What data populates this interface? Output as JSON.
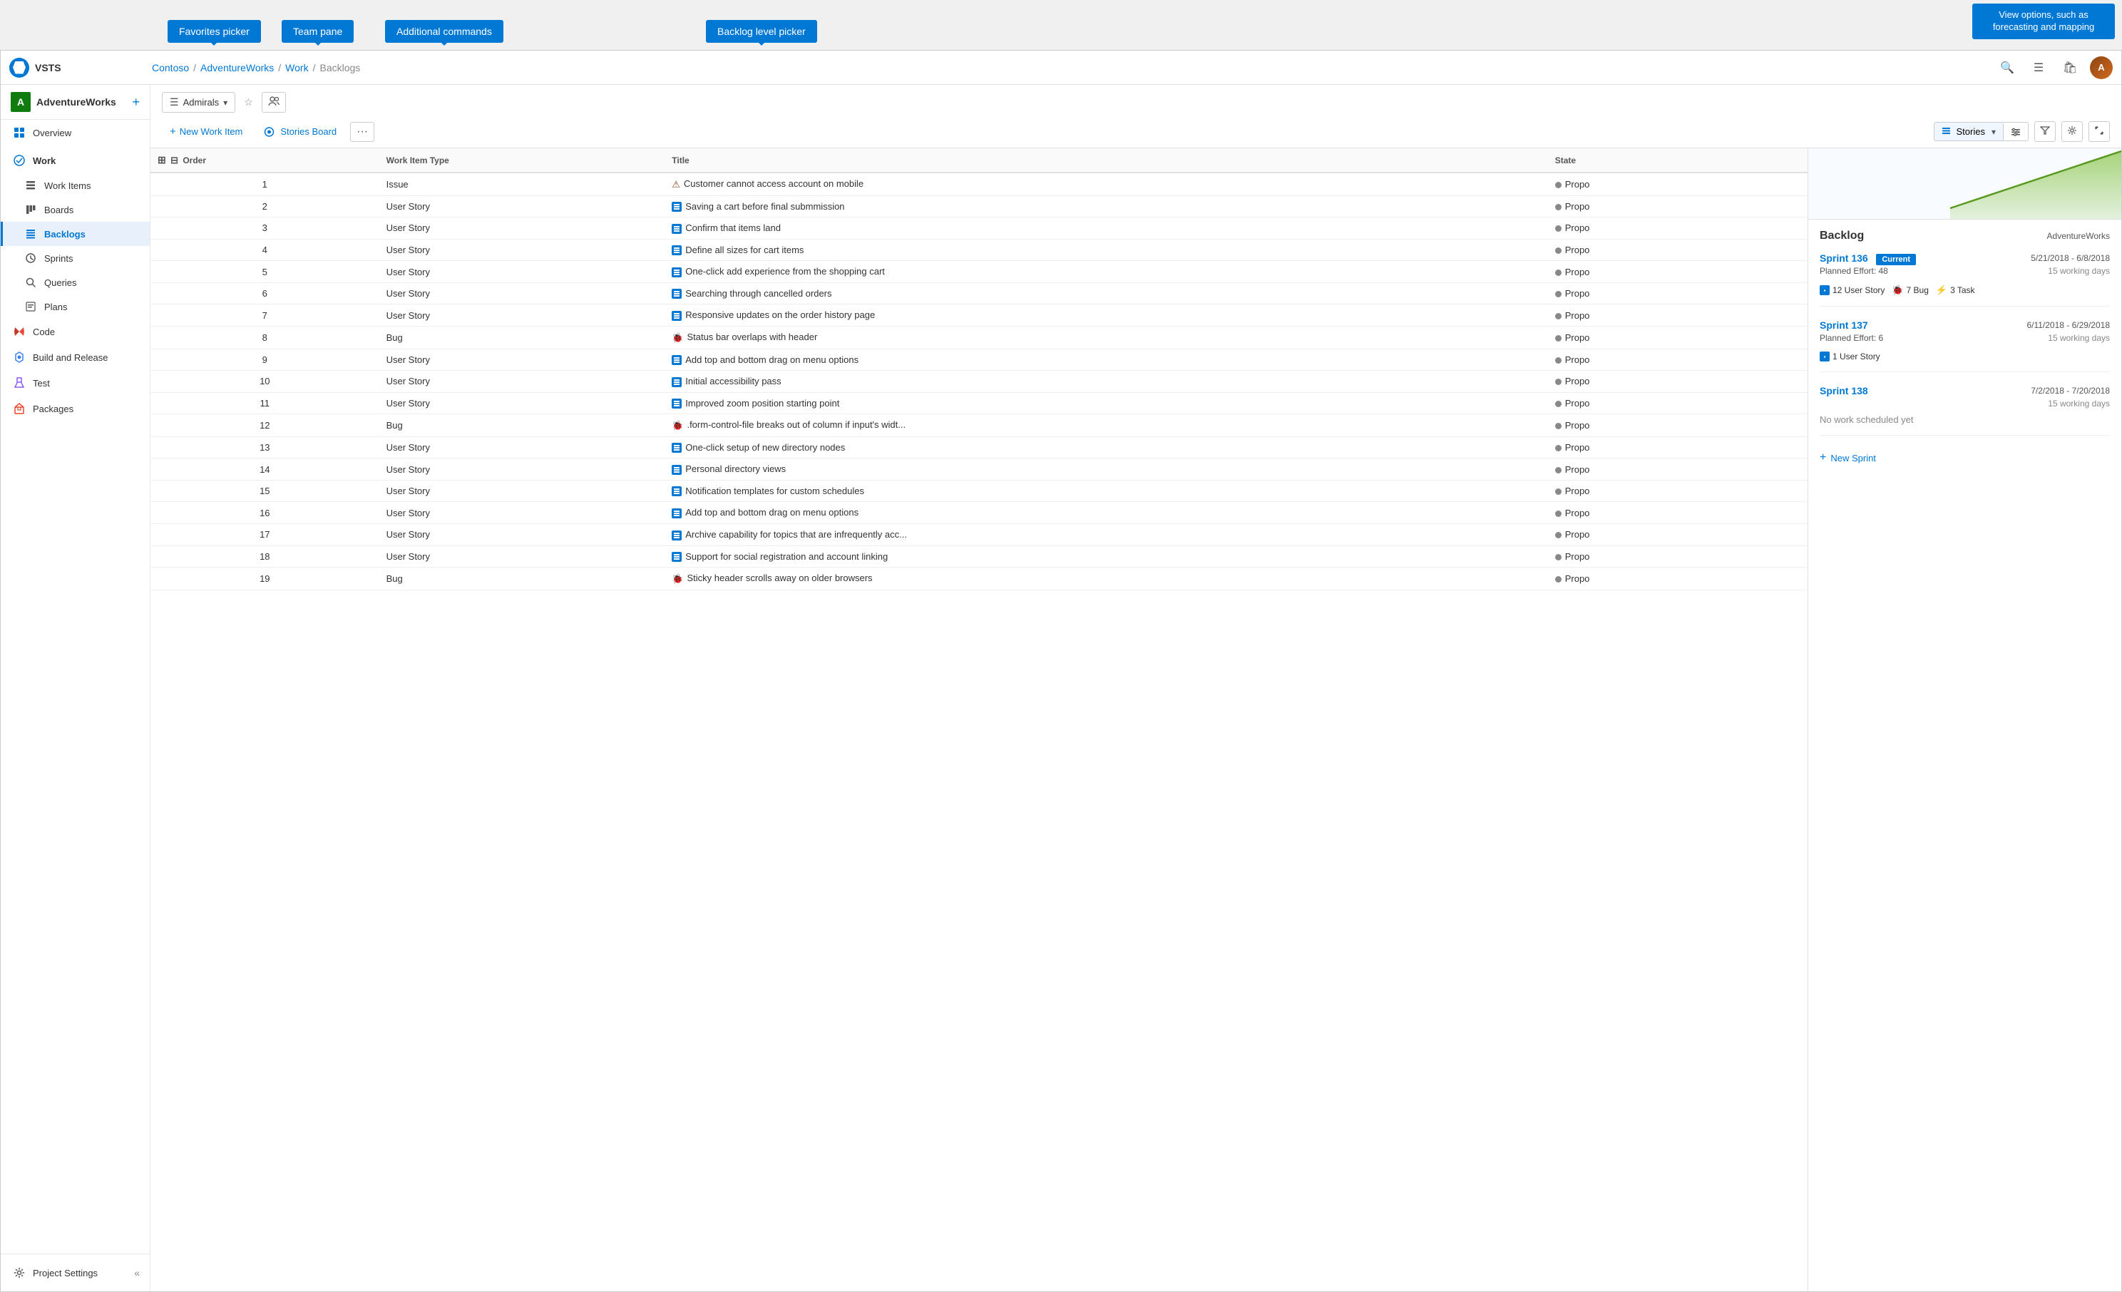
{
  "app": {
    "title": "VSTS"
  },
  "tooltips": {
    "favorites_picker": "Favorites picker",
    "team_pane": "Team pane",
    "additional_commands": "Additional commands",
    "backlog_level_picker": "Backlog level picker",
    "view_options": "View options, such as forecasting and mapping"
  },
  "header": {
    "breadcrumb": [
      "Contoso",
      "AdventureWorks",
      "Work",
      "Backlogs"
    ],
    "separator": "/"
  },
  "sidebar": {
    "project_letter": "A",
    "project_name": "AdventureWorks",
    "nav_items": [
      {
        "id": "overview",
        "label": "Overview",
        "icon": "⊞",
        "active": false
      },
      {
        "id": "work",
        "label": "Work",
        "icon": "✓",
        "active": false,
        "section": true
      },
      {
        "id": "work-items",
        "label": "Work Items",
        "icon": "☰",
        "active": false,
        "indent": true
      },
      {
        "id": "boards",
        "label": "Boards",
        "icon": "⊞",
        "active": false,
        "indent": true
      },
      {
        "id": "backlogs",
        "label": "Backlogs",
        "icon": "≡",
        "active": true,
        "indent": true
      },
      {
        "id": "sprints",
        "label": "Sprints",
        "icon": "◷",
        "active": false,
        "indent": true
      },
      {
        "id": "queries",
        "label": "Queries",
        "icon": "⚡",
        "active": false,
        "indent": true
      },
      {
        "id": "plans",
        "label": "Plans",
        "icon": "📋",
        "active": false,
        "indent": true
      },
      {
        "id": "code",
        "label": "Code",
        "icon": "◈",
        "active": false
      },
      {
        "id": "build-release",
        "label": "Build and Release",
        "icon": "🚀",
        "active": false
      },
      {
        "id": "test",
        "label": "Test",
        "icon": "⚗",
        "active": false
      },
      {
        "id": "packages",
        "label": "Packages",
        "icon": "📦",
        "active": false
      }
    ],
    "bottom": {
      "label": "Project Settings",
      "icon": "⚙",
      "collapse_icon": "«"
    }
  },
  "content": {
    "team_selector": "Admirals",
    "actions": {
      "new_work_item": "New Work Item",
      "stories_board": "Stories Board",
      "more": "···"
    },
    "view": {
      "label": "Stories",
      "filter_icon": "filter",
      "settings_icon": "settings",
      "expand_icon": "expand"
    },
    "table": {
      "columns": [
        "Order",
        "Work Item Type",
        "Title",
        "State"
      ],
      "rows": [
        {
          "order": 1,
          "type": "Issue",
          "type_icon": "issue",
          "title": "Customer cannot access account on mobile",
          "state": "Propo"
        },
        {
          "order": 2,
          "type": "User Story",
          "type_icon": "story",
          "title": "Saving a cart before final submmission",
          "state": "Propo"
        },
        {
          "order": 3,
          "type": "User Story",
          "type_icon": "story",
          "title": "Confirm that items land",
          "state": "Propo"
        },
        {
          "order": 4,
          "type": "User Story",
          "type_icon": "story",
          "title": "Define all sizes for cart items",
          "state": "Propo"
        },
        {
          "order": 5,
          "type": "User Story",
          "type_icon": "story",
          "title": "One-click add experience from the shopping cart",
          "state": "Propo"
        },
        {
          "order": 6,
          "type": "User Story",
          "type_icon": "story",
          "title": "Searching through cancelled orders",
          "state": "Propo"
        },
        {
          "order": 7,
          "type": "User Story",
          "type_icon": "story",
          "title": "Responsive updates on the order history page",
          "state": "Propo"
        },
        {
          "order": 8,
          "type": "Bug",
          "type_icon": "bug",
          "title": "Status bar overlaps with header",
          "state": "Propo"
        },
        {
          "order": 9,
          "type": "User Story",
          "type_icon": "story",
          "title": "Add top and bottom drag on menu options",
          "state": "Propo"
        },
        {
          "order": 10,
          "type": "User Story",
          "type_icon": "story",
          "title": "Initial accessibility pass",
          "state": "Propo"
        },
        {
          "order": 11,
          "type": "User Story",
          "type_icon": "story",
          "title": "Improved zoom position starting point",
          "state": "Propo"
        },
        {
          "order": 12,
          "type": "Bug",
          "type_icon": "bug",
          "title": ".form-control-file breaks out of column if input's widt...",
          "state": "Propo"
        },
        {
          "order": 13,
          "type": "User Story",
          "type_icon": "story",
          "title": "One-click setup of new directory nodes",
          "state": "Propo"
        },
        {
          "order": 14,
          "type": "User Story",
          "type_icon": "story",
          "title": "Personal directory views",
          "state": "Propo"
        },
        {
          "order": 15,
          "type": "User Story",
          "type_icon": "story",
          "title": "Notification templates for custom schedules",
          "state": "Propo"
        },
        {
          "order": 16,
          "type": "User Story",
          "type_icon": "story",
          "title": "Add top and bottom drag on menu options",
          "state": "Propo"
        },
        {
          "order": 17,
          "type": "User Story",
          "type_icon": "story",
          "title": "Archive capability for topics that are infrequently acc...",
          "state": "Propo"
        },
        {
          "order": 18,
          "type": "User Story",
          "type_icon": "story",
          "title": "Support for social registration and account linking",
          "state": "Propo"
        },
        {
          "order": 19,
          "type": "Bug",
          "type_icon": "bug",
          "title": "Sticky header scrolls away on older browsers",
          "state": "Propo"
        }
      ]
    }
  },
  "right_panel": {
    "title": "Backlog",
    "project": "AdventureWorks",
    "sprints": [
      {
        "name": "Sprint 136",
        "badge": "Current",
        "date_range": "5/21/2018 - 6/8/2018",
        "effort_label": "Planned Effort: 48",
        "work_days": "15 working days",
        "items": [
          {
            "count": 12,
            "type": "User Story",
            "icon": "story"
          },
          {
            "count": 7,
            "type": "Bug",
            "icon": "bug"
          },
          {
            "count": 3,
            "type": "Task",
            "icon": "task"
          }
        ],
        "no_work": false
      },
      {
        "name": "Sprint 137",
        "badge": null,
        "date_range": "6/11/2018 - 6/29/2018",
        "effort_label": "Planned Effort: 6",
        "work_days": "15 working days",
        "items": [
          {
            "count": 1,
            "type": "User Story",
            "icon": "story"
          }
        ],
        "no_work": false
      },
      {
        "name": "Sprint 138",
        "badge": null,
        "date_range": "7/2/2018 - 7/20/2018",
        "effort_label": null,
        "work_days": "15 working days",
        "items": [],
        "no_work": true,
        "no_work_text": "No work scheduled yet"
      }
    ],
    "new_sprint_label": "New Sprint"
  }
}
